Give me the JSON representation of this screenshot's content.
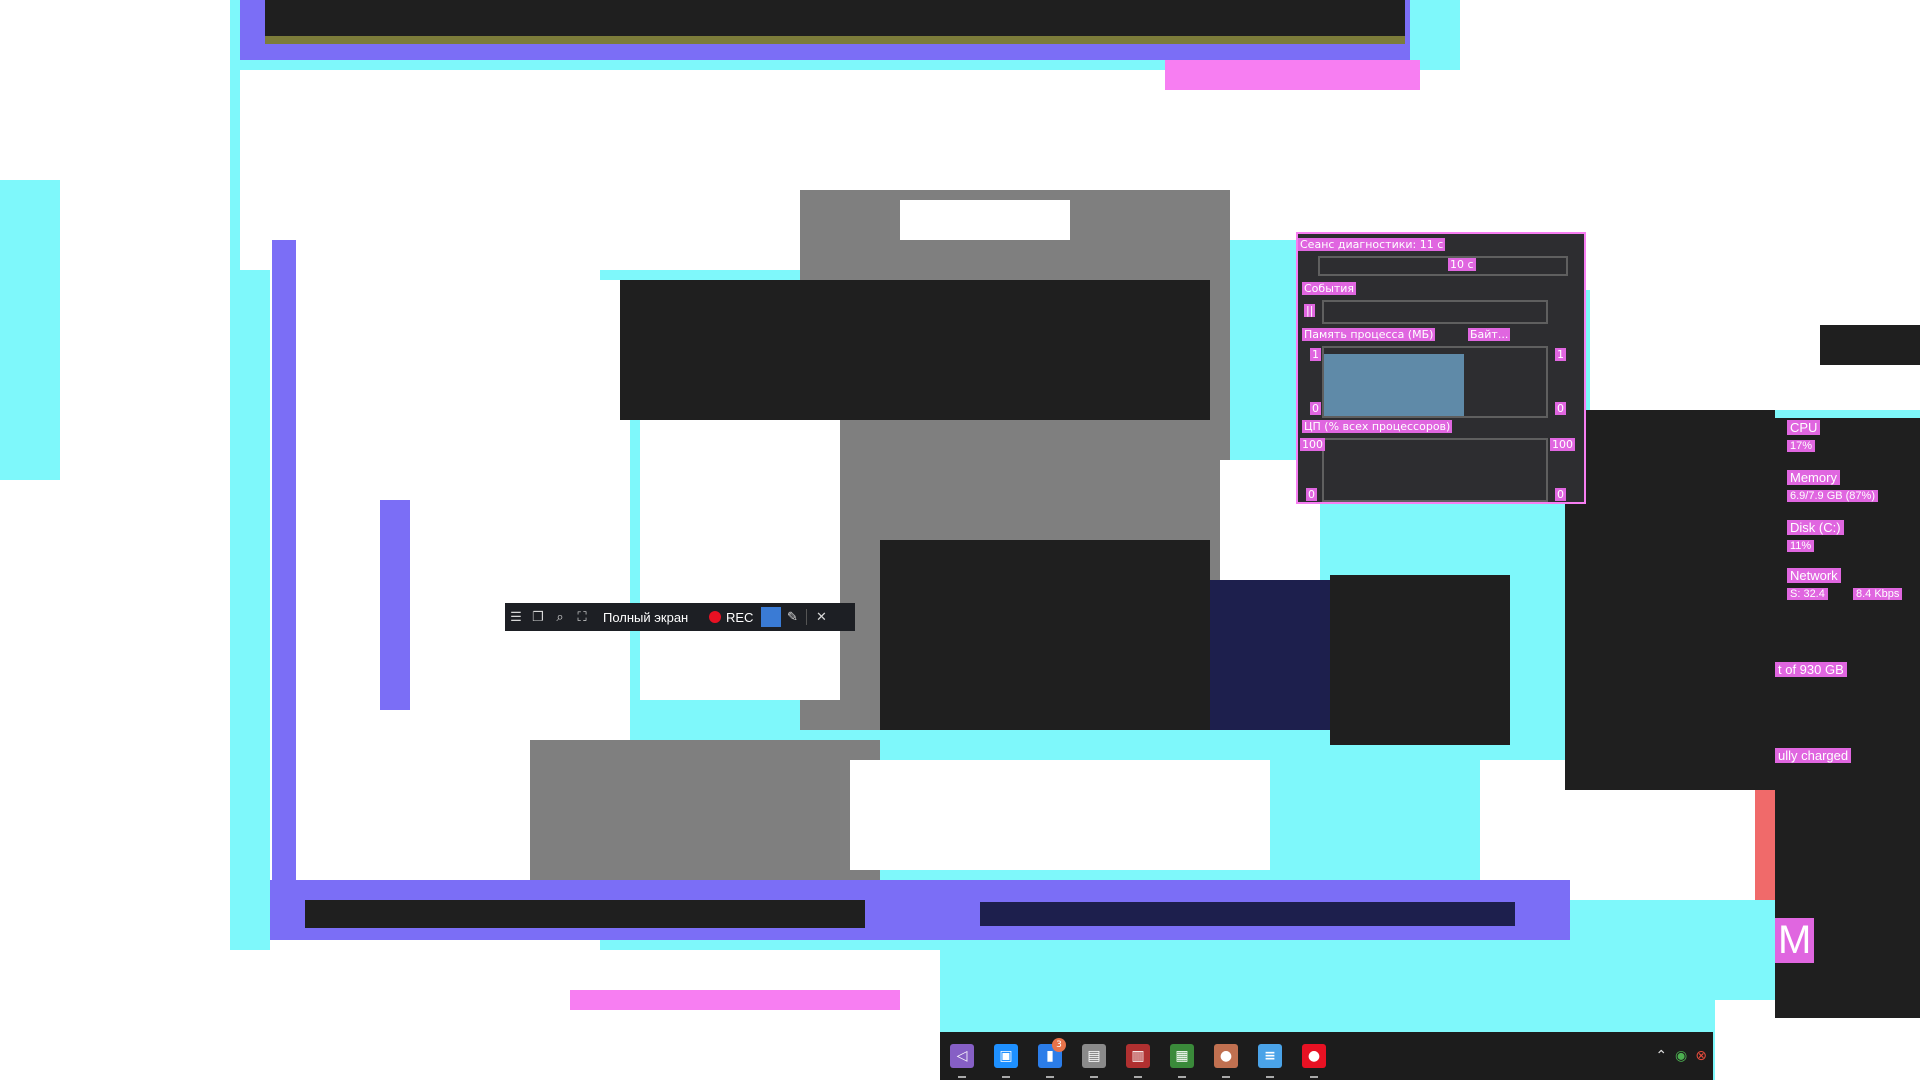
{
  "diagnostics": {
    "session_title": "Сеанс диагностики: 11 с",
    "timeline_label": "10 с",
    "events_title": "События",
    "events_pause_icon": "pause-icon",
    "memory_title": "Память процесса (МБ)",
    "memory_option": "Байт...",
    "memory_axis_max_left": "1",
    "memory_axis_min_left": "0",
    "memory_axis_max_right": "1",
    "memory_axis_min_right": "0",
    "cpu_title": "ЦП (% всех процессоров)",
    "cpu_axis_max_left": "100",
    "cpu_axis_min_left": "0",
    "cpu_axis_max_right": "100",
    "cpu_axis_min_right": "0"
  },
  "recording_toolbar": {
    "mode_label": "Полный экран",
    "rec_label": "REC",
    "icons": [
      "menu-icon",
      "window-icon",
      "region-icon",
      "crop-icon",
      "pen-icon",
      "close-icon"
    ]
  },
  "performance": {
    "cpu_label": "CPU",
    "cpu_value": "17%",
    "memory_label": "Memory",
    "memory_value": "6.9/7.9 GB (87%)",
    "disk_label": "Disk (C:)",
    "disk_value": "11%",
    "network_label": "Network",
    "network_value_s": "S: 32.4",
    "network_value_r": "8.4 Kbps",
    "disk_capacity": "t of 930 GB",
    "battery_status": "ully charged",
    "letter": "M"
  },
  "taskbar": {
    "apps": [
      {
        "name": "visual-studio",
        "icon": "visual-studio-icon",
        "color": "#865fc5",
        "glyph": "◁"
      },
      {
        "name": "virtual-desktop",
        "icon": "windows-stack-icon",
        "color": "#1e90ff",
        "glyph": "▣"
      },
      {
        "name": "phone",
        "icon": "phone-icon",
        "color": "#2b7de9",
        "glyph": "▮",
        "badge": "3"
      },
      {
        "name": "installer",
        "icon": "installer-icon",
        "color": "#8a8a8a",
        "glyph": "▤"
      },
      {
        "name": "archiver",
        "icon": "archive-icon",
        "color": "#b03030",
        "glyph": "▥"
      },
      {
        "name": "terminal-app",
        "icon": "monitor-icon",
        "color": "#3a8a3a",
        "glyph": "▦"
      },
      {
        "name": "media-app",
        "icon": "person-icon",
        "color": "#c07050",
        "glyph": "●"
      },
      {
        "name": "notepad",
        "icon": "notepad-icon",
        "color": "#4aa3e8",
        "glyph": "≡"
      },
      {
        "name": "recorder",
        "icon": "record-icon",
        "color": "#e81123",
        "glyph": "●"
      }
    ],
    "tray_icons": [
      "chevron-up-icon",
      "status-circle-icon",
      "network-warning-icon"
    ]
  }
}
